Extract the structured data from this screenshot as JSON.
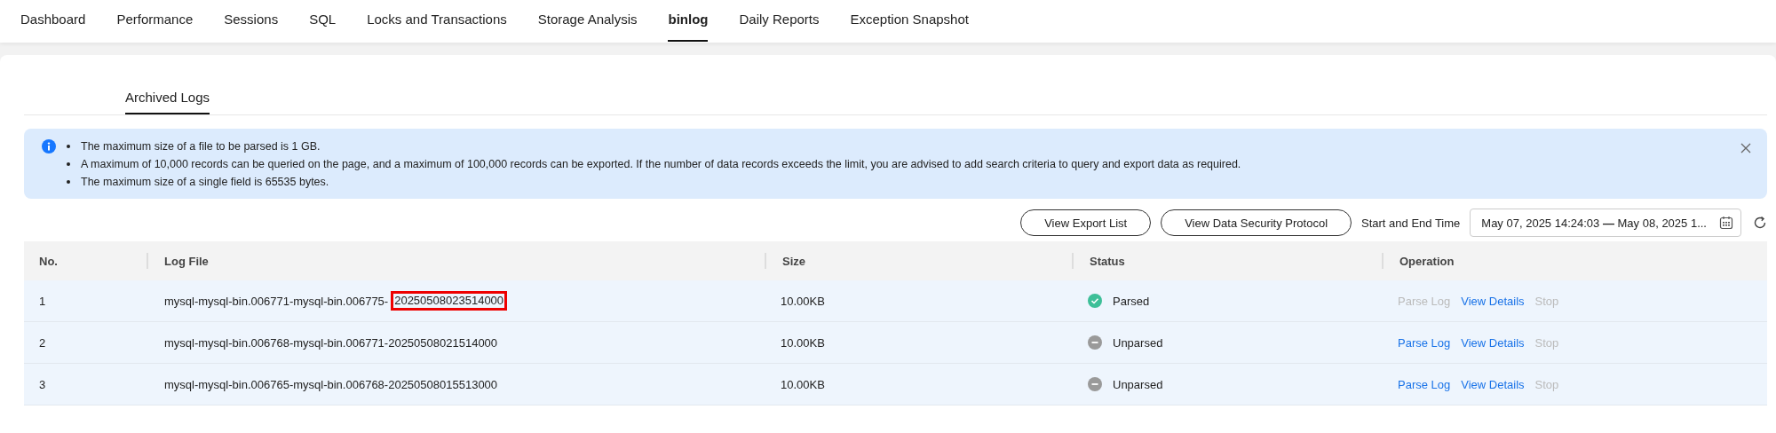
{
  "nav_tabs": [
    {
      "label": "Dashboard",
      "selected": false
    },
    {
      "label": "Performance",
      "selected": false
    },
    {
      "label": "Sessions",
      "selected": false
    },
    {
      "label": "SQL",
      "selected": false
    },
    {
      "label": "Locks and Transactions",
      "selected": false
    },
    {
      "label": "Storage Analysis",
      "selected": false
    },
    {
      "label": "binlog",
      "selected": true
    },
    {
      "label": "Daily Reports",
      "selected": false
    },
    {
      "label": "Exception Snapshot",
      "selected": false
    }
  ],
  "sub_tabs": [
    {
      "label": "Archived Logs",
      "selected": true
    }
  ],
  "notice": {
    "items": [
      "The maximum size of a file to be parsed is 1 GB.",
      "A maximum of 10,000 records can be queried on the page, and a maximum of 100,000 records can be exported. If the number of data records exceeds the limit, you are advised to add search criteria to query and export data as required.",
      "The maximum size of a single field is 65535 bytes."
    ]
  },
  "toolbar": {
    "buttons": [
      "View Export List",
      "View Data Security Protocol"
    ],
    "time_label": "Start and End Time",
    "time_range": {
      "start": "May 07, 2025 14:24:03",
      "separator": "—",
      "end": "May 08, 2025 1..."
    }
  },
  "table": {
    "columns": [
      "No.",
      "Log File",
      "Size",
      "Status",
      "Operation"
    ],
    "rows": [
      {
        "no": "1",
        "log_file": "mysql-mysql-bin.006771-mysql-bin.006775-",
        "highlighted": "20250508023514000",
        "size": "10.00KB",
        "status": {
          "kind": "parsed",
          "label": "Parsed"
        },
        "operations": [
          {
            "label": "Parse Log",
            "disabled": true
          },
          {
            "label": "View Details",
            "disabled": false
          },
          {
            "label": "Stop",
            "disabled": true
          }
        ]
      },
      {
        "no": "2",
        "log_file": "mysql-mysql-bin.006768-mysql-bin.006771-20250508021514000",
        "size": "10.00KB",
        "status": {
          "kind": "unparsed",
          "label": "Unparsed"
        },
        "operations": [
          {
            "label": "Parse Log",
            "disabled": false
          },
          {
            "label": "View Details",
            "disabled": false
          },
          {
            "label": "Stop",
            "disabled": true
          }
        ]
      },
      {
        "no": "3",
        "log_file": "mysql-mysql-bin.006765-mysql-bin.006768-20250508015513000",
        "size": "10.00KB",
        "status": {
          "kind": "unparsed",
          "label": "Unparsed"
        },
        "operations": [
          {
            "label": "Parse Log",
            "disabled": false
          },
          {
            "label": "View Details",
            "disabled": false
          },
          {
            "label": "Stop",
            "disabled": true
          }
        ]
      }
    ]
  }
}
